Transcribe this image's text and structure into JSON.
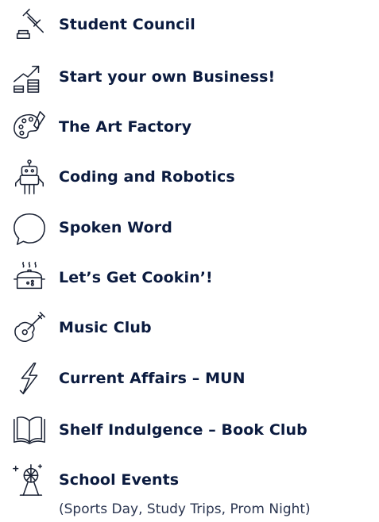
{
  "clubs": [
    {
      "label": "Student Council",
      "icon": "gavel-icon"
    },
    {
      "label": "Start your own Business!",
      "icon": "growth-chart-icon"
    },
    {
      "label": "The Art Factory",
      "icon": "palette-icon"
    },
    {
      "label": "Coding and Robotics",
      "icon": "robot-icon"
    },
    {
      "label": "Spoken Word",
      "icon": "speech-bubble-icon"
    },
    {
      "label": "Let’s Get Cookin’!",
      "icon": "cooking-pot-icon"
    },
    {
      "label": "Music Club",
      "icon": "guitar-icon"
    },
    {
      "label": "Current Affairs – MUN",
      "icon": "lightning-icon"
    },
    {
      "label": "Shelf Indulgence – Book Club",
      "icon": "open-book-icon"
    },
    {
      "label": "School Events",
      "icon": "disco-ball-icon",
      "subtitle": "(Sports Day, Study Trips, Prom Night)"
    }
  ]
}
